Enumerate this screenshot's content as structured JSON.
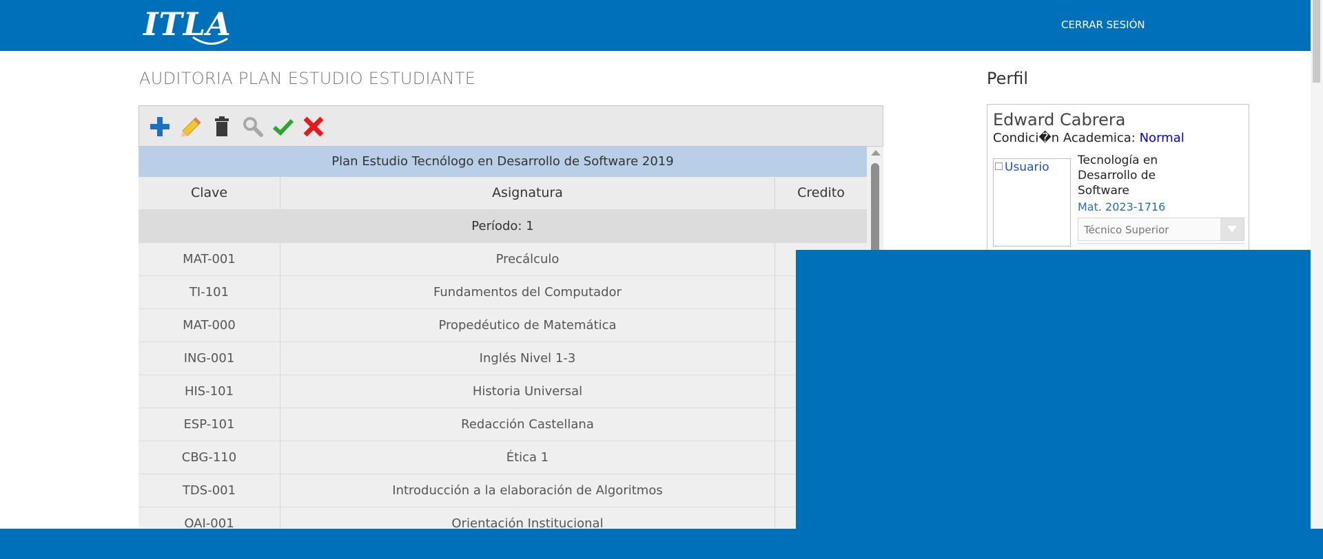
{
  "header": {
    "logo_text": "ITLA",
    "logout_label": "CERRAR SESIÓN"
  },
  "page_title": "AUDITORIA PLAN ESTUDIO ESTUDIANTE",
  "toolbar": {
    "icons": [
      "add-icon",
      "edit-pencil-icon",
      "delete-trash-icon",
      "search-magnifier-icon",
      "confirm-check-icon",
      "cancel-x-icon"
    ],
    "colors": {
      "add": "#1d6fc2",
      "edit": "#f2c531",
      "delete": "#3a3a3a",
      "search": "#a8a8a8",
      "confirm": "#2fa52f",
      "cancel": "#e11b1b"
    }
  },
  "table": {
    "plan_title": "Plan Estudio Tecnólogo en Desarrollo de Software 2019",
    "columns": [
      "Clave",
      "Asignatura",
      "Credito"
    ],
    "period_label": "Período: 1",
    "rows": [
      {
        "clave": "MAT-001",
        "asignatura": "Precálculo"
      },
      {
        "clave": "TI-101",
        "asignatura": "Fundamentos del Computador"
      },
      {
        "clave": "MAT-000",
        "asignatura": "Propedéutico de Matemática"
      },
      {
        "clave": "ING-001",
        "asignatura": "Inglés Nivel 1-3"
      },
      {
        "clave": "HIS-101",
        "asignatura": "Historia Universal"
      },
      {
        "clave": "ESP-101",
        "asignatura": "Redacción Castellana"
      },
      {
        "clave": "CBG-110",
        "asignatura": "Ética 1"
      },
      {
        "clave": "TDS-001",
        "asignatura": "Introducción a la elaboración de Algoritmos"
      },
      {
        "clave": "OAI-001",
        "asignatura": "Orientación Institucional"
      }
    ]
  },
  "profile": {
    "section_title": "Perfil",
    "name": "Edward Cabrera",
    "condition_label": "Condici�n Academica:",
    "condition_value": "Normal",
    "photo_alt": "Usuario",
    "career": "Tecnología en Desarrollo de Software",
    "matricula": "Mat. 2023-1716",
    "level_select": "Técnico Superior"
  },
  "colors": {
    "brand_blue": "#0070bb",
    "plan_header_bg": "#b9cfe7",
    "link_blue": "#0000ee"
  }
}
